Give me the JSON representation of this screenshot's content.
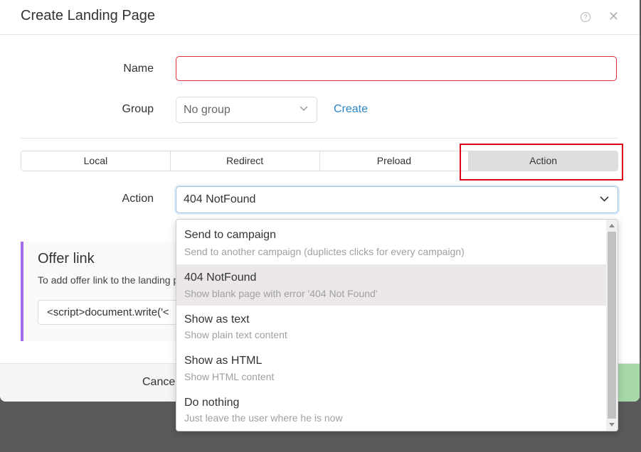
{
  "modal": {
    "title": "Create Landing Page",
    "help_glyph": "?",
    "close_glyph": "✕"
  },
  "form": {
    "name_label": "Name",
    "name_value": "",
    "group_label": "Group",
    "group_value": "No group",
    "create_label": "Create",
    "action_label": "Action",
    "action_value": "404 NotFound"
  },
  "tabs": [
    {
      "label": "Local"
    },
    {
      "label": "Redirect"
    },
    {
      "label": "Preload"
    },
    {
      "label": "Action",
      "active": true
    }
  ],
  "offer": {
    "title": "Offer link",
    "description": "To add offer link to the landing p",
    "code": "<script>document.write('<"
  },
  "footer": {
    "cancel_label": "Cancel"
  },
  "dropdown": {
    "options": [
      {
        "title": "Send to campaign",
        "desc": "Send to another campaign (duplictes clicks for every campaign)"
      },
      {
        "title": "404 NotFound",
        "desc": "Show blank page with error '404 Not Found'",
        "selected": true
      },
      {
        "title": "Show as text",
        "desc": "Show plain text content"
      },
      {
        "title": "Show as HTML",
        "desc": "Show HTML content"
      },
      {
        "title": "Do nothing",
        "desc": "Just leave the user where he is now"
      }
    ]
  },
  "colors": {
    "accent_link": "#2a87c9",
    "error_border": "#e0303a",
    "highlight": "#e0001b",
    "offer_accent": "#a56be8",
    "save_green": "#a6d8a9"
  }
}
